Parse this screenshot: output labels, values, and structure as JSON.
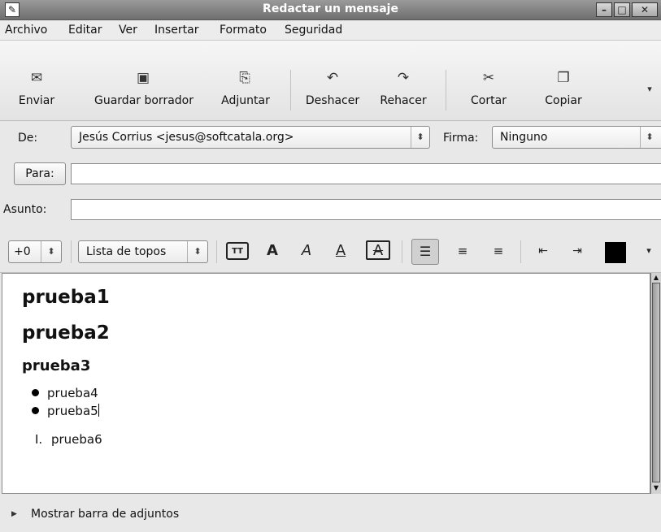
{
  "window": {
    "title": "Redactar un mensaje",
    "app_icon": "pencil-icon",
    "controls": [
      "minimize-icon",
      "maximize-icon",
      "close-icon"
    ]
  },
  "menu": {
    "items": [
      "Archivo",
      "Editar",
      "Ver",
      "Insertar",
      "Formato",
      "Seguridad"
    ]
  },
  "toolbar": {
    "buttons": [
      {
        "label": "Enviar",
        "icon": "send-envelope-icon"
      },
      {
        "label": "Guardar borrador",
        "icon": "floppy-disk-icon"
      },
      {
        "label": "Adjuntar",
        "icon": "paperclip-icon"
      },
      {
        "label": "Deshacer",
        "icon": "undo-icon"
      },
      {
        "label": "Rehacer",
        "icon": "redo-icon"
      },
      {
        "label": "Cortar",
        "icon": "scissors-icon"
      },
      {
        "label": "Copiar",
        "icon": "copy-icon"
      }
    ],
    "overflow_icon": "chevron-down-icon"
  },
  "header": {
    "from_label": "De:",
    "from_value": "Jesús Corrius <jesus@softcatala.org>",
    "signature_label": "Firma:",
    "signature_value": "Ninguno",
    "to_label": "Para:",
    "to_value": "",
    "subject_label": "Asunto:",
    "subject_value": ""
  },
  "format": {
    "font_size": "+0",
    "paragraph_style": "Lista de topos",
    "buttons": [
      "teletype-icon",
      "bold-icon",
      "italic-icon",
      "underline-icon",
      "strikethrough-icon",
      "align-left-icon",
      "align-center-icon",
      "align-right-icon",
      "outdent-icon",
      "indent-icon",
      "text-color-swatch"
    ],
    "text_color": "#000000"
  },
  "editor": {
    "heading1": "prueba1",
    "heading2": "prueba2",
    "heading3": "prueba3",
    "bullets": [
      "prueba4",
      "prueba5"
    ],
    "numbered_marker": "I.",
    "numbered_item": "prueba6"
  },
  "attachments": {
    "toggle_label": "Mostrar barra de adjuntos"
  }
}
